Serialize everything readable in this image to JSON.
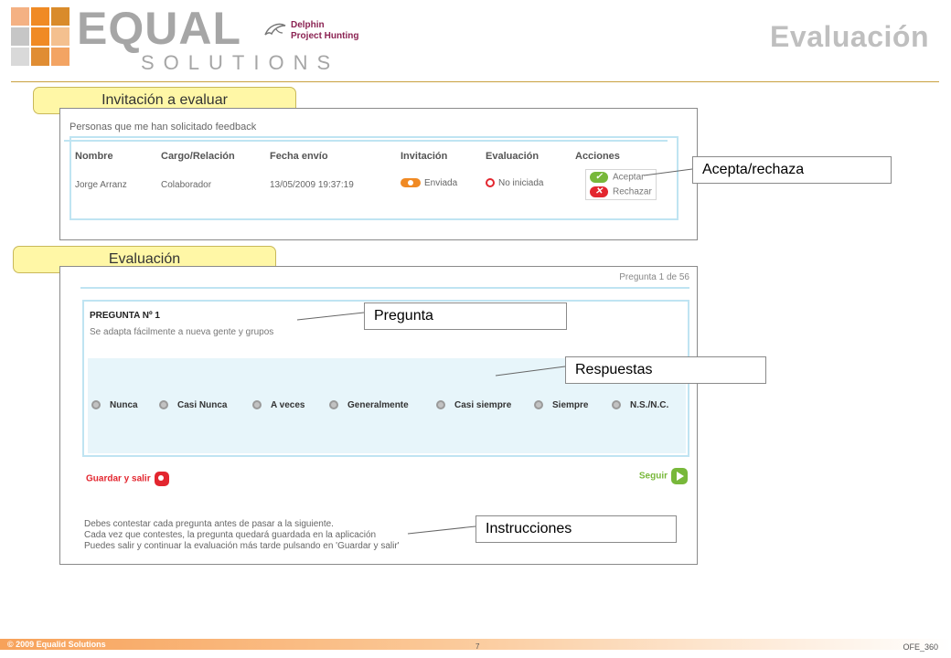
{
  "header": {
    "logo_word": "EQUAL",
    "logo_sub": "SOLUTIONS",
    "partner_line1": "Delphin",
    "partner_line2": "Project Hunting",
    "page_title": "Evaluación"
  },
  "colors": {
    "accent_orange": "#f08a24",
    "tab_yellow": "#fff7a6",
    "table_border_blue": "#bfe4f2",
    "answers_bg": "#e7f5fa",
    "reject_red": "#e3262f",
    "accept_green": "#78b83a",
    "logo_grid": [
      "#f4b183",
      "#f08a24",
      "#d98b2b",
      "#c6c6c6",
      "#f08a24",
      "#f4c08f",
      "#d9d9d9",
      "#e08d33",
      "#f3a463"
    ]
  },
  "invitation_section": {
    "tab_label": "Invitación a evaluar",
    "caption": "Personas que me han solicitado feedback",
    "columns": [
      "Nombre",
      "Cargo/Relación",
      "Fecha envío",
      "Invitación",
      "Evaluación",
      "Acciones"
    ],
    "row": {
      "name": "Jorge Arranz",
      "role": "Colaborador",
      "date": "13/05/2009 19:37:19",
      "invitation": "Enviada",
      "evaluation": "No iniciada",
      "accept": "Aceptar",
      "reject": "Rechazar"
    }
  },
  "evaluation_section": {
    "tab_label": "Evaluación",
    "page_indicator": "Pregunta 1 de 56",
    "question_title": "PREGUNTA Nº 1",
    "question_text": "Se adapta fácilmente a nueva gente y grupos",
    "options": [
      "Nunca",
      "Casi Nunca",
      "A veces",
      "Generalmente",
      "Casi siempre",
      "Siempre",
      "N.S./N.C."
    ],
    "save_label": "Guardar y salir",
    "next_label": "Seguir",
    "instructions": [
      "Debes contestar cada pregunta antes de pasar a la siguiente.",
      "Cada vez que contestes, la pregunta quedará guardada en la aplicación",
      "Puedes salir y continuar la evaluación más tarde pulsando en 'Guardar y salir'"
    ]
  },
  "callouts": {
    "accept_reject": "Acepta/rechaza",
    "question": "Pregunta",
    "answers": "Respuestas",
    "instructions": "Instrucciones"
  },
  "footer": {
    "copyright": "© 2009 Equalid Solutions",
    "page_number": "7",
    "code": "OFE_360"
  }
}
